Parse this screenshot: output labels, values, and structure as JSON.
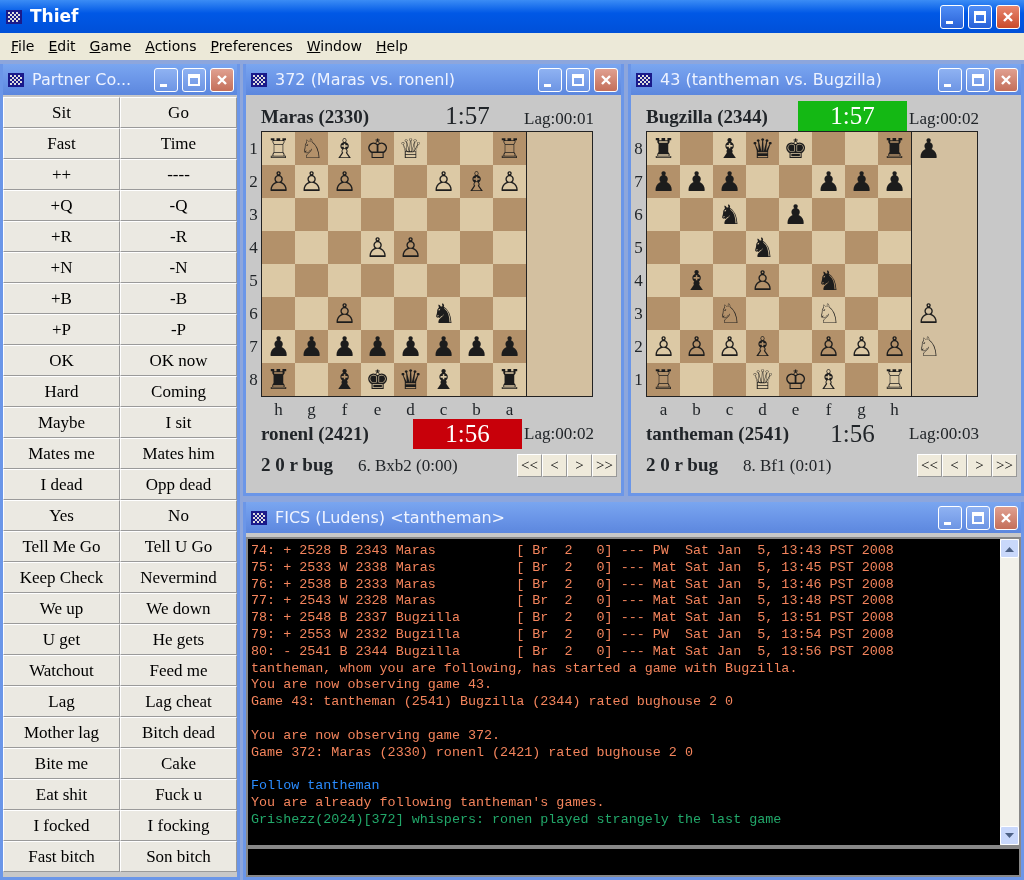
{
  "window": {
    "title": "Thief"
  },
  "menu": [
    "File",
    "Edit",
    "Game",
    "Actions",
    "Preferences",
    "Window",
    "Help"
  ],
  "partner_console": {
    "title": "Partner Co...",
    "buttons": [
      "Sit",
      "Go",
      "Fast",
      "Time",
      "++",
      "----",
      "+Q",
      "-Q",
      "+R",
      "-R",
      "+N",
      "-N",
      "+B",
      "-B",
      "+P",
      "-P",
      "OK",
      "OK now",
      "Hard",
      "Coming",
      "Maybe",
      "I sit",
      "Mates me",
      "Mates him",
      "I dead",
      "Opp dead",
      "Yes",
      "No",
      "Tell Me Go",
      "Tell U Go",
      "Keep Check",
      "Nevermind",
      "We up",
      "We down",
      "U get",
      "He gets",
      "Watchout",
      "Feed me",
      "Lag",
      "Lag cheat",
      "Mother lag",
      "Bitch dead",
      "Bite me",
      "Cake",
      "Eat shit",
      "Fuck u",
      "I focked",
      "I focking",
      "Fast bitch",
      "Son bitch"
    ]
  },
  "boards": [
    {
      "title": "372 (Maras vs. ronenl)",
      "top_player": "Maras (2330)",
      "top_clock": {
        "text": "1:57"
      },
      "top_lag": "Lag:00:01",
      "rank_labels": [
        "1",
        "2",
        "3",
        "4",
        "5",
        "6",
        "7",
        "8"
      ],
      "file_labels": [
        "h",
        "g",
        "f",
        "e",
        "d",
        "c",
        "b",
        "a"
      ],
      "squares": [
        [
          {
            "occupied": true,
            "piece": "♖"
          },
          {
            "occupied": true,
            "piece": "♘"
          },
          {
            "occupied": true,
            "piece": "♗"
          },
          {
            "occupied": true,
            "piece": "♔"
          },
          {
            "occupied": true,
            "piece": "♕"
          },
          {
            "occupied": false
          },
          {
            "occupied": false
          },
          {
            "occupied": true,
            "piece": "♖"
          }
        ],
        [
          {
            "occupied": true,
            "piece": "♙"
          },
          {
            "occupied": true,
            "piece": "♙"
          },
          {
            "occupied": true,
            "piece": "♙"
          },
          {
            "occupied": false
          },
          {
            "occupied": false
          },
          {
            "occupied": true,
            "piece": "♙"
          },
          {
            "occupied": true,
            "piece": "♗"
          },
          {
            "occupied": true,
            "piece": "♙"
          }
        ],
        [
          {
            "occupied": false
          },
          {
            "occupied": false
          },
          {
            "occupied": false
          },
          {
            "occupied": false
          },
          {
            "occupied": false
          },
          {
            "occupied": false
          },
          {
            "occupied": false
          },
          {
            "occupied": false
          }
        ],
        [
          {
            "occupied": false
          },
          {
            "occupied": false
          },
          {
            "occupied": false
          },
          {
            "occupied": true,
            "piece": "♙"
          },
          {
            "occupied": true,
            "piece": "♙"
          },
          {
            "occupied": false
          },
          {
            "occupied": false
          },
          {
            "occupied": false
          }
        ],
        [
          {
            "occupied": false
          },
          {
            "occupied": false
          },
          {
            "occupied": false
          },
          {
            "occupied": false
          },
          {
            "occupied": false
          },
          {
            "occupied": false
          },
          {
            "occupied": false
          },
          {
            "occupied": false
          }
        ],
        [
          {
            "occupied": false
          },
          {
            "occupied": false
          },
          {
            "occupied": true,
            "piece": "♙"
          },
          {
            "occupied": false
          },
          {
            "occupied": false
          },
          {
            "occupied": true,
            "piece": "♞"
          },
          {
            "occupied": false
          },
          {
            "occupied": false
          }
        ],
        [
          {
            "occupied": true,
            "piece": "♟"
          },
          {
            "occupied": true,
            "piece": "♟"
          },
          {
            "occupied": true,
            "piece": "♟"
          },
          {
            "occupied": true,
            "piece": "♟"
          },
          {
            "occupied": true,
            "piece": "♟"
          },
          {
            "occupied": true,
            "piece": "♟"
          },
          {
            "occupied": true,
            "piece": "♟"
          },
          {
            "occupied": true,
            "piece": "♟"
          }
        ],
        [
          {
            "occupied": true,
            "piece": "♜"
          },
          {
            "occupied": false
          },
          {
            "occupied": true,
            "piece": "♝"
          },
          {
            "occupied": true,
            "piece": "♚"
          },
          {
            "occupied": true,
            "piece": "♛"
          },
          {
            "occupied": true,
            "piece": "♝"
          },
          {
            "occupied": false
          },
          {
            "occupied": true,
            "piece": "♜"
          }
        ]
      ],
      "bottom_player": "ronenl (2421)",
      "bottom_clock": {
        "text": "1:56",
        "color": "#c8000a"
      },
      "bottom_lag": "Lag:00:02",
      "game_type": "2 0 r bug",
      "last_move": "6. Bxb2 (0:00)",
      "nav_buttons": [
        "<<",
        "<",
        ">",
        ">>"
      ]
    },
    {
      "title": "43 (tantheman vs. Bugzilla)",
      "top_player": "Bugzilla (2344)",
      "top_clock": {
        "text": "1:57",
        "color": "#14b814"
      },
      "top_lag": "Lag:00:02",
      "rank_labels": [
        "8",
        "7",
        "6",
        "5",
        "4",
        "3",
        "2",
        "1"
      ],
      "file_labels": [
        "a",
        "b",
        "c",
        "d",
        "e",
        "f",
        "g",
        "h"
      ],
      "squares": [
        [
          {
            "occupied": true,
            "piece": "♜"
          },
          {
            "occupied": false
          },
          {
            "occupied": true,
            "piece": "♝"
          },
          {
            "occupied": true,
            "piece": "♛"
          },
          {
            "occupied": true,
            "piece": "♚"
          },
          {
            "occupied": false
          },
          {
            "occupied": false
          },
          {
            "occupied": true,
            "piece": "♜"
          }
        ],
        [
          {
            "occupied": true,
            "piece": "♟"
          },
          {
            "occupied": true,
            "piece": "♟"
          },
          {
            "occupied": true,
            "piece": "♟"
          },
          {
            "occupied": false
          },
          {
            "occupied": false
          },
          {
            "occupied": true,
            "piece": "♟"
          },
          {
            "occupied": true,
            "piece": "♟"
          },
          {
            "occupied": true,
            "piece": "♟"
          }
        ],
        [
          {
            "occupied": false
          },
          {
            "occupied": false
          },
          {
            "occupied": true,
            "piece": "♞"
          },
          {
            "occupied": false
          },
          {
            "occupied": true,
            "piece": "♟"
          },
          {
            "occupied": false
          },
          {
            "occupied": false
          },
          {
            "occupied": false
          }
        ],
        [
          {
            "occupied": false
          },
          {
            "occupied": false
          },
          {
            "occupied": false
          },
          {
            "occupied": true,
            "piece": "♞"
          },
          {
            "occupied": false
          },
          {
            "occupied": false
          },
          {
            "occupied": false
          },
          {
            "occupied": false
          }
        ],
        [
          {
            "occupied": false
          },
          {
            "occupied": true,
            "piece": "♝"
          },
          {
            "occupied": false
          },
          {
            "occupied": true,
            "piece": "♙"
          },
          {
            "occupied": false
          },
          {
            "occupied": true,
            "piece": "♞"
          },
          {
            "occupied": false
          },
          {
            "occupied": false
          }
        ],
        [
          {
            "occupied": false
          },
          {
            "occupied": false
          },
          {
            "occupied": true,
            "piece": "♘"
          },
          {
            "occupied": false
          },
          {
            "occupied": false
          },
          {
            "occupied": true,
            "piece": "♘"
          },
          {
            "occupied": false
          },
          {
            "occupied": false
          }
        ],
        [
          {
            "occupied": true,
            "piece": "♙"
          },
          {
            "occupied": true,
            "piece": "♙"
          },
          {
            "occupied": true,
            "piece": "♙"
          },
          {
            "occupied": true,
            "piece": "♗"
          },
          {
            "occupied": false
          },
          {
            "occupied": true,
            "piece": "♙"
          },
          {
            "occupied": true,
            "piece": "♙"
          },
          {
            "occupied": true,
            "piece": "♙"
          }
        ],
        [
          {
            "occupied": true,
            "piece": "♖"
          },
          {
            "occupied": false
          },
          {
            "occupied": false
          },
          {
            "occupied": true,
            "piece": "♕"
          },
          {
            "occupied": true,
            "piece": "♔"
          },
          {
            "occupied": true,
            "piece": "♗"
          },
          {
            "occupied": false
          },
          {
            "occupied": true,
            "piece": "♖"
          }
        ]
      ],
      "holdings": {
        "top": [
          "♟"
        ],
        "bottom": [
          "♙",
          "♘"
        ]
      },
      "bottom_player": "tantheman (2541)",
      "bottom_clock": {
        "text": "1:56"
      },
      "bottom_lag": "Lag:00:03",
      "game_type": "2 0 r bug",
      "last_move": "8. Bf1 (0:01)",
      "nav_buttons": [
        "<<",
        "<",
        ">",
        ">>"
      ]
    }
  ],
  "console": {
    "title": "FICS (Ludens) <tantheman>",
    "lines": [
      {
        "kind": "output",
        "text": "74: + 2528 B 2343 Maras          [ Br  2   0] --- PW  Sat Jan  5, 13:43 PST 2008"
      },
      {
        "kind": "output",
        "text": "75: + 2533 W 2338 Maras          [ Br  2   0] --- Mat Sat Jan  5, 13:45 PST 2008"
      },
      {
        "kind": "output",
        "text": "76: + 2538 B 2333 Maras          [ Br  2   0] --- Mat Sat Jan  5, 13:46 PST 2008"
      },
      {
        "kind": "output",
        "text": "77: + 2543 W 2328 Maras          [ Br  2   0] --- Mat Sat Jan  5, 13:48 PST 2008"
      },
      {
        "kind": "output",
        "text": "78: + 2548 B 2337 Bugzilla       [ Br  2   0] --- Mat Sat Jan  5, 13:51 PST 2008"
      },
      {
        "kind": "output",
        "text": "79: + 2553 W 2332 Bugzilla       [ Br  2   0] --- PW  Sat Jan  5, 13:54 PST 2008"
      },
      {
        "kind": "output",
        "text": "80: - 2541 B 2344 Bugzilla       [ Br  2   0] --- Mat Sat Jan  5, 13:56 PST 2008"
      },
      {
        "kind": "output",
        "text": "tantheman, whom you are following, has started a game with Bugzilla."
      },
      {
        "kind": "output",
        "text": "You are now observing game 43."
      },
      {
        "kind": "output",
        "text": "Game 43: tantheman (2541) Bugzilla (2344) rated bughouse 2 0"
      },
      {
        "kind": "blank"
      },
      {
        "kind": "output",
        "text": "You are now observing game 372."
      },
      {
        "kind": "output",
        "text": "Game 372: Maras (2330) ronenl (2421) rated bughouse 2 0"
      },
      {
        "kind": "blank"
      },
      {
        "kind": "command",
        "text": "Follow tantheman"
      },
      {
        "kind": "output",
        "text": "You are already following tantheman's games."
      },
      {
        "kind": "whisper",
        "text": "Grishezz(2024)[372] whispers: ronen played strangely the last game"
      }
    ]
  }
}
